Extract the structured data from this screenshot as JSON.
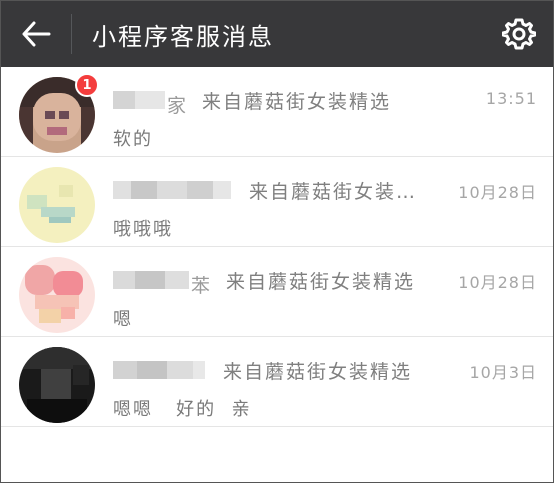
{
  "header": {
    "title": "小程序客服消息"
  },
  "conversations": [
    {
      "name_visible": "家",
      "source": "来自蘑菇街女装精选",
      "time": "13:51",
      "preview": "软的",
      "unread": "1"
    },
    {
      "name_visible": "",
      "source": "来自蘑菇街女装…",
      "time": "10月28日",
      "preview": "哦哦哦"
    },
    {
      "name_visible": "苯",
      "source": "来自蘑菇街女装精选",
      "time": "10月28日",
      "preview": "嗯"
    },
    {
      "name_visible": "",
      "source": "来自蘑菇街女装精选",
      "time": "10月3日",
      "preview": "嗯嗯   好的  亲"
    }
  ],
  "colors": {
    "header_bg": "#38383a",
    "badge": "#f43d3d"
  },
  "icons": {
    "back": "arrow-left-icon",
    "settings": "gear-icon"
  }
}
